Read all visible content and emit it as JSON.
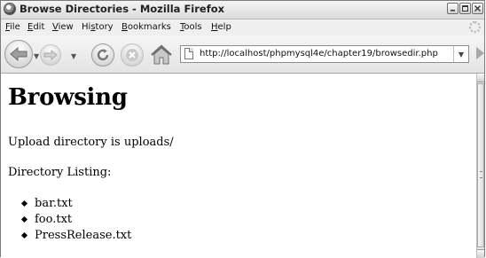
{
  "window": {
    "title": "Browse Directories - Mozilla Firefox"
  },
  "menu": {
    "items": [
      "File",
      "Edit",
      "View",
      "History",
      "Bookmarks",
      "Tools",
      "Help"
    ],
    "mnemonic": [
      "F",
      "E",
      "V",
      "s",
      "B",
      "T",
      "H"
    ]
  },
  "toolbar": {
    "url": "http://localhost/phpmysql4e/chapter19/browsedir.php",
    "icons": [
      "back-icon",
      "forward-icon",
      "reload-icon",
      "stop-icon",
      "home-icon",
      "page-icon",
      "go-icon"
    ]
  },
  "page": {
    "heading": "Browsing",
    "upload_text": "Upload directory is uploads/",
    "listing_label": "Directory Listing:",
    "files": [
      "bar.txt",
      "foo.txt",
      "PressRelease.txt"
    ]
  }
}
